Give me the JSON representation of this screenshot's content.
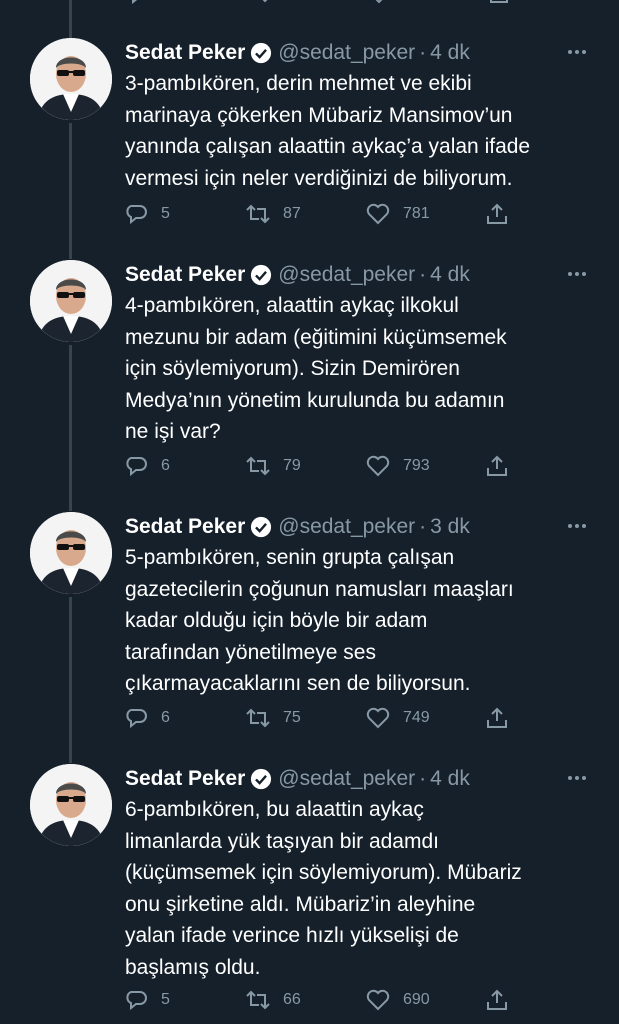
{
  "tweets": [
    {
      "name": "Sedat Peker",
      "handle": "@sedat_peker",
      "separator": "·",
      "time": "4 dk",
      "lines": [
        "3-pambıkören, derin mehmet ve ekibi",
        "marinaya çökerken Mübariz Mansimov’un",
        "yanında çalışan alaattin aykaç’a yalan ifade",
        "vermesi için neler verdiğinizi de biliyorum."
      ],
      "replies": "5",
      "retweets": "87",
      "likes": "781"
    },
    {
      "name": "Sedat Peker",
      "handle": "@sedat_peker",
      "separator": "·",
      "time": "4 dk",
      "lines": [
        "4-pambıkören, alaattin aykaç ilkokul",
        "mezunu bir adam (eğitimini küçümsemek",
        "için söylemiyorum). Sizin Demirören",
        "Medya’nın yönetim kurulunda bu adamın",
        "ne işi var?"
      ],
      "replies": "6",
      "retweets": "79",
      "likes": "793"
    },
    {
      "name": "Sedat Peker",
      "handle": "@sedat_peker",
      "separator": "·",
      "time": "3 dk",
      "lines": [
        "5-pambıkören, senin grupta çalışan",
        "gazetecilerin çoğunun namusları maaşları",
        "kadar olduğu için böyle bir adam",
        "tarafından yönetilmeye ses",
        "çıkarmayacaklarını sen de biliyorsun."
      ],
      "replies": "6",
      "retweets": "75",
      "likes": "749"
    },
    {
      "name": "Sedat Peker",
      "handle": "@sedat_peker",
      "separator": "·",
      "time": "4 dk",
      "lines": [
        "6-pambıkören, bu alaattin aykaç",
        "limanlarda yük taşıyan bir adamdı",
        "(küçümsemek için söylemiyorum). Mübariz",
        "onu şirketine aldı. Mübariz’in aleyhine",
        "yalan ifade verince hızlı yükselişi de",
        "başlamış oldu."
      ],
      "replies": "5",
      "retweets": "66",
      "likes": "690"
    }
  ],
  "icons": {
    "verified": "verified-badge-icon",
    "more": "more-dots-icon",
    "reply": "reply-bubble-icon",
    "retweet": "retweet-arrows-icon",
    "like": "heart-icon",
    "share": "share-upload-icon"
  },
  "colors": {
    "background": "#15202b",
    "text": "#ffffff",
    "muted": "#8899a6",
    "thread_line": "#38444d"
  }
}
